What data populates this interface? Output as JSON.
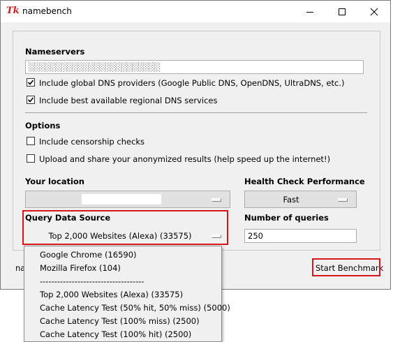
{
  "window": {
    "title": "namebench",
    "icon": "tk-icon"
  },
  "nameservers": {
    "heading": "Nameservers",
    "value": "░░░░░░░░░░░░░░░░░░░░░░░░",
    "global_label": "Include global DNS providers (Google Public DNS, OpenDNS, UltraDNS, etc.)",
    "global_checked": true,
    "regional_label": "Include best available regional DNS services",
    "regional_checked": true
  },
  "options": {
    "heading": "Options",
    "censorship_label": "Include censorship checks",
    "censorship_checked": false,
    "upload_label": "Upload and share your anonymized results (help speed up the internet!)",
    "upload_checked": false
  },
  "location": {
    "heading": "Your location",
    "value": ""
  },
  "health": {
    "heading": "Health Check Performance",
    "value": "Fast"
  },
  "query_source": {
    "heading": "Query Data Source",
    "value": "Top 2,000 Websites (Alexa) (33575)"
  },
  "queries": {
    "heading": "Number of queries",
    "value": "250"
  },
  "status_text": "na",
  "start_button": "Start Benchmark",
  "dropdown_items": [
    "Google Chrome (16590)",
    "Mozilla Firefox (104)",
    "------------------------------------",
    "Top 2,000 Websites (Alexa) (33575)",
    "Cache Latency Test (50% hit, 50% miss) (5000)",
    "Cache Latency Test (100% miss) (2500)",
    "Cache Latency Test (100% hit) (2500)"
  ],
  "colors": {
    "highlight_red": "#d9151c",
    "window_bg": "#f0f0f0"
  }
}
